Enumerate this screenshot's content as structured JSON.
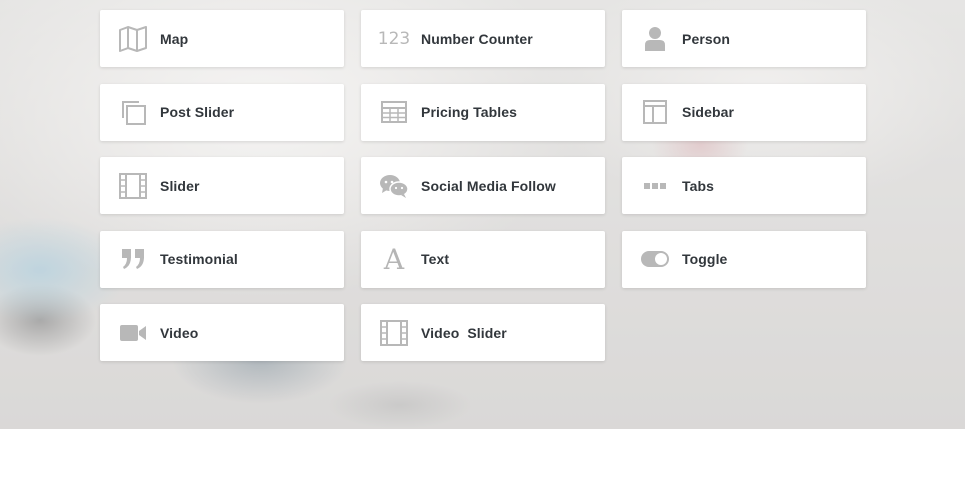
{
  "modules": [
    {
      "label": "Map",
      "icon": "map-icon"
    },
    {
      "label": "Number Counter",
      "icon": "number-counter-icon",
      "icon_text": "123"
    },
    {
      "label": "Person",
      "icon": "person-icon"
    },
    {
      "label": "Post Slider",
      "icon": "post-slider-icon"
    },
    {
      "label": "Pricing Tables",
      "icon": "pricing-tables-icon"
    },
    {
      "label": "Sidebar",
      "icon": "sidebar-icon"
    },
    {
      "label": "Slider",
      "icon": "slider-icon"
    },
    {
      "label": "Social Media Follow",
      "icon": "social-media-follow-icon"
    },
    {
      "label": "Tabs",
      "icon": "tabs-icon"
    },
    {
      "label": "Testimonial",
      "icon": "testimonial-icon"
    },
    {
      "label": "Text",
      "icon": "text-icon",
      "icon_text": "A"
    },
    {
      "label": "Toggle",
      "icon": "toggle-icon"
    },
    {
      "label": "Video",
      "icon": "video-icon"
    },
    {
      "label": "Video  Slider",
      "icon": "video-slider-icon"
    }
  ],
  "colors": {
    "icon": "#b8b8b8",
    "label": "#32373c",
    "card": "#ffffff"
  }
}
